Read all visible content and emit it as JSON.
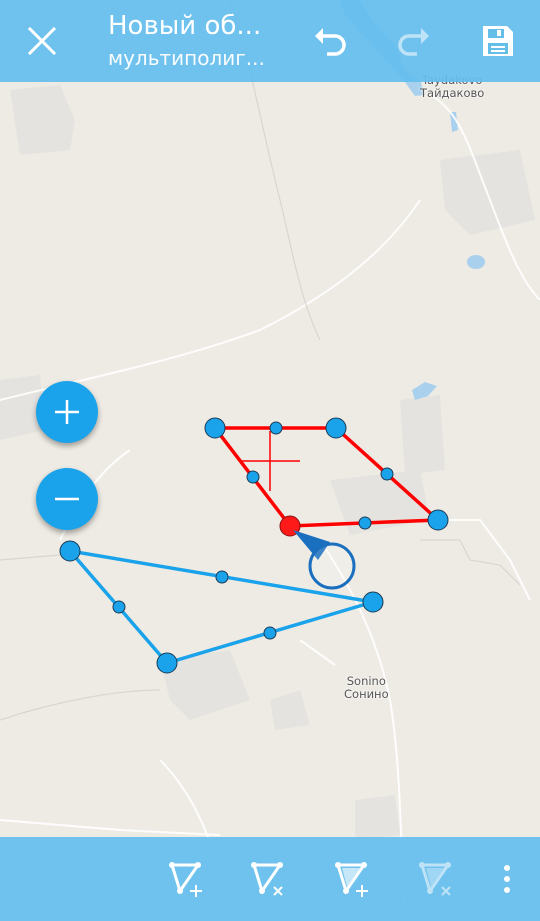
{
  "app": {
    "title": "Новый об...",
    "subtitle": "мультиполиг...",
    "accent_color": "#64bee8",
    "fab_color": "#1aa3eb",
    "active_polygon_color": "#ff0000",
    "inactive_polygon_color": "#1aa3eb"
  },
  "toolbar": {
    "close_icon": "close-icon",
    "undo_icon": "undo-icon",
    "redo_icon": "redo-icon",
    "save_icon": "save-icon"
  },
  "map": {
    "labels": [
      {
        "latin": "Taydakovo",
        "cyrillic": "Тайдаково"
      },
      {
        "latin": "Sonino",
        "cyrillic": "Сонино"
      }
    ]
  },
  "zoom": {
    "in_icon": "plus-icon",
    "out_icon": "minus-icon"
  },
  "bottom_toolbar": {
    "items": [
      {
        "icon": "add-vertex-icon"
      },
      {
        "icon": "delete-vertex-icon"
      },
      {
        "icon": "add-part-icon"
      },
      {
        "icon": "delete-part-icon"
      },
      {
        "icon": "more-vert-icon"
      }
    ]
  }
}
